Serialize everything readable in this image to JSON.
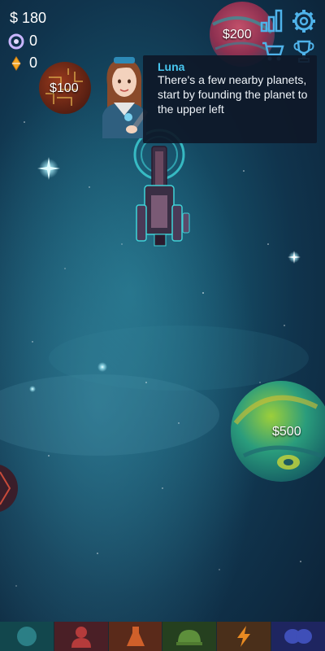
{
  "hud": {
    "money": "$ 180",
    "gems": "0",
    "crystals": "0"
  },
  "planets": [
    {
      "price": "$200"
    },
    {
      "price": "$100"
    },
    {
      "price": "$500"
    }
  ],
  "dialog": {
    "speaker": "Luna",
    "message": "There's a few nearby planets, start by founding the planet to the upper left"
  },
  "top_icons": [
    "stats-icon",
    "settings-icon",
    "shop-cart-icon",
    "trophy-icon"
  ],
  "tabs": [
    {
      "name": "planet-tab",
      "color": "#2b7f86"
    },
    {
      "name": "crew-tab",
      "color": "#b53b3b"
    },
    {
      "name": "research-tab",
      "color": "#c9622a"
    },
    {
      "name": "army-tab",
      "color": "#5d8f3b"
    },
    {
      "name": "power-tab",
      "color": "#d77f24"
    },
    {
      "name": "fleet-tab",
      "color": "#3f4fb8"
    }
  ]
}
